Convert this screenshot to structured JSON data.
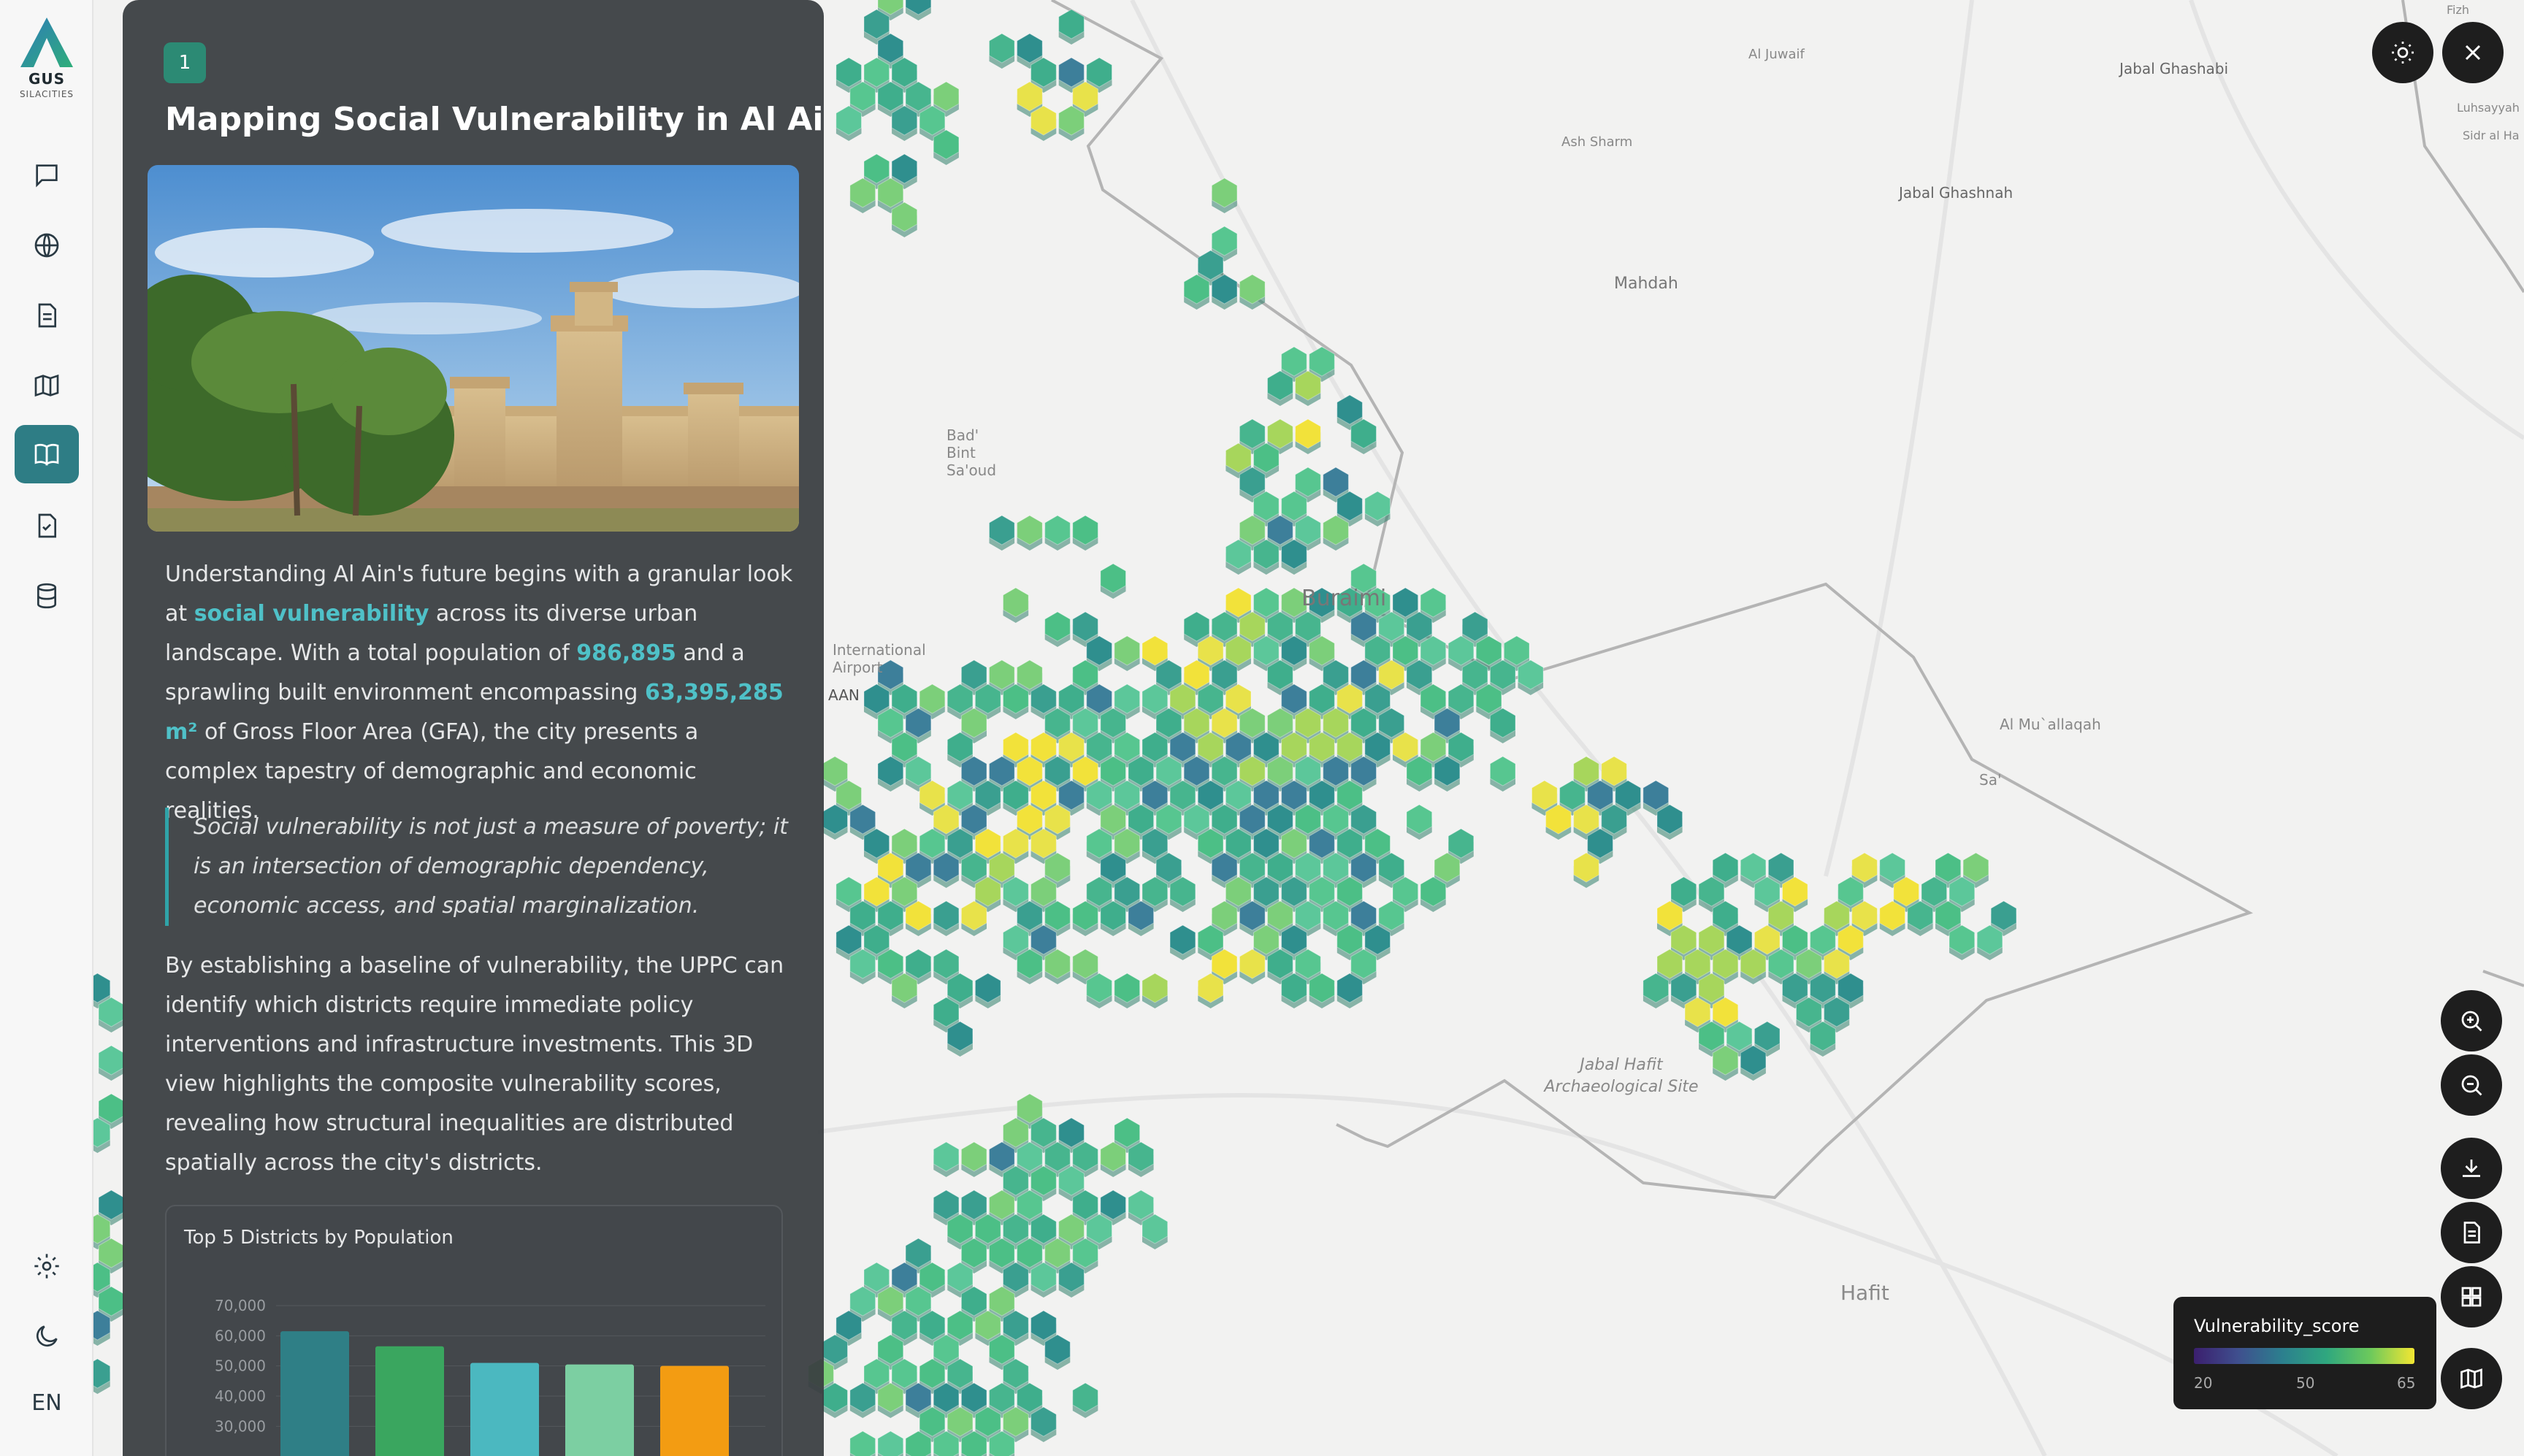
{
  "app": {
    "brand": "GUS",
    "sub_brand": "SILACITIES",
    "language": "EN"
  },
  "sidebar": {
    "items": [
      {
        "name": "chat-icon"
      },
      {
        "name": "globe-icon"
      },
      {
        "name": "document-icon"
      },
      {
        "name": "map-icon"
      },
      {
        "name": "book-icon",
        "active": true
      },
      {
        "name": "checklist-icon"
      },
      {
        "name": "database-icon"
      }
    ],
    "bottom": [
      {
        "name": "gear-icon"
      },
      {
        "name": "moon-icon"
      }
    ]
  },
  "story": {
    "step": "1",
    "title": "Mapping Social Vulnerability in Al Ain",
    "para1_a": "Understanding Al Ain's future begins with a granular look at",
    "para1_b": "social vulnerability",
    "para1_c": " across its diverse urban landscape. With a total population of ",
    "para1_d": "986,895",
    "para1_e": " and a sprawling built environment encompassing ",
    "para1_f": "63,395,285 m²",
    "para1_g": " of Gross Floor Area (GFA), the city presents a complex tapestry of demographic and economic realities.",
    "quote": "Social vulnerability is not just a measure of poverty; it is an intersection of demographic dependency, economic access, and spatial marginalization.",
    "para2": "By establishing a baseline of vulnerability, the UPPC can identify which districts require immediate policy interventions and infrastructure investments. This 3D view highlights the composite vulnerability scores, revealing how structural inequalities are distributed spatially across the city's districts."
  },
  "chart_data": {
    "type": "bar",
    "title": "Top 5 Districts by Population",
    "categories": [
      "",
      "",
      "",
      "",
      ""
    ],
    "values": [
      61500,
      56500,
      51000,
      50500,
      50000
    ],
    "colors": [
      "#2f7f86",
      "#3aa65f",
      "#4bb8c0",
      "#7ccfa2",
      "#f39c12"
    ],
    "yticks": [
      "70,000",
      "60,000",
      "50,000",
      "40,000",
      "30,000"
    ],
    "ylim": [
      25000,
      70000
    ]
  },
  "map": {
    "labels": [
      {
        "text": "Al Juwaif"
      },
      {
        "text": "Ash Sharm"
      },
      {
        "text": "Jabal Ghashabi"
      },
      {
        "text": "Jabal Ghashnah"
      },
      {
        "text": "Mahdah"
      },
      {
        "text": "Bad' Bint Sa'oud"
      },
      {
        "text": "Buraimi"
      },
      {
        "text": "International Airport"
      },
      {
        "text": "AAN"
      },
      {
        "text": "Al Mu`allaqah"
      },
      {
        "text": "Sa'"
      },
      {
        "text": "Jabal Hafit Archaeological Site"
      },
      {
        "text": "Hafit"
      },
      {
        "text": "Fizh"
      },
      {
        "text": "Luhsayyah"
      },
      {
        "text": "Sidr al Ha"
      }
    ]
  },
  "controls": [
    {
      "name": "theme-toggle-button",
      "icon": "sun-icon"
    },
    {
      "name": "close-button",
      "icon": "close-icon"
    },
    {
      "name": "zoom-in-button",
      "icon": "zoom-in-icon"
    },
    {
      "name": "zoom-out-button",
      "icon": "zoom-out-icon"
    },
    {
      "name": "download-button",
      "icon": "download-icon"
    },
    {
      "name": "report-button",
      "icon": "document-icon"
    },
    {
      "name": "layers-button",
      "icon": "grid-icon"
    },
    {
      "name": "basemap-button",
      "icon": "map-icon"
    }
  ],
  "legend": {
    "title": "Vulnerability_score",
    "min": "20",
    "mid": "50",
    "max": "65",
    "colors": [
      "#3b1f6e",
      "#2c7f8e",
      "#2fa77f",
      "#6cc95c",
      "#f3e632"
    ]
  }
}
